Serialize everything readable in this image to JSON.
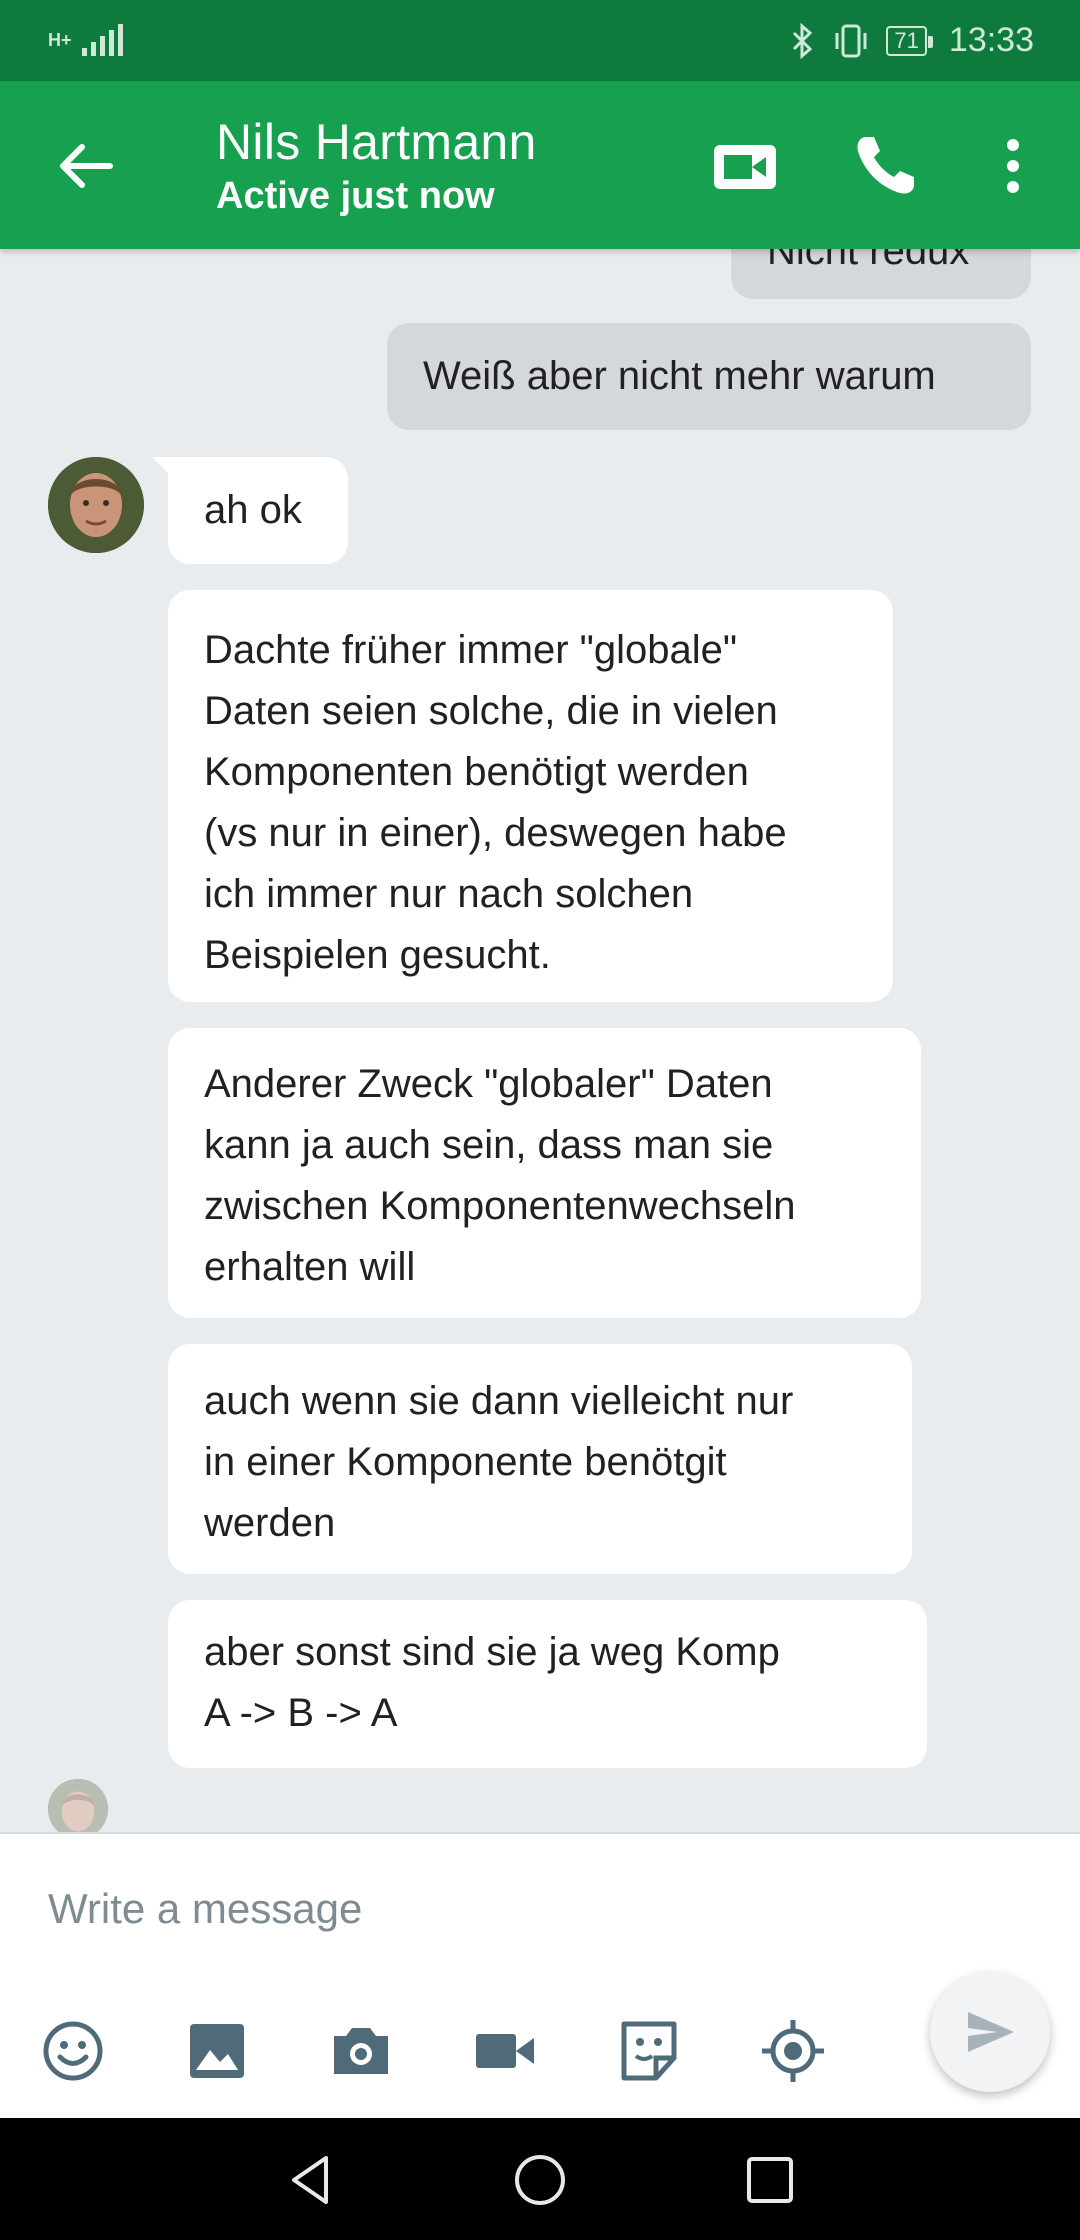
{
  "status_bar": {
    "time": "13:33",
    "battery": "71",
    "network": "H+"
  },
  "header": {
    "contact_name": "Nils Hartmann",
    "contact_status": "Active just now"
  },
  "messages": [
    {
      "direction": "out",
      "text": "Nicht redux"
    },
    {
      "direction": "out",
      "text": "Weiß aber nicht mehr warum"
    },
    {
      "direction": "in",
      "text": "ah ok"
    },
    {
      "direction": "in",
      "lines": [
        "Dachte früher immer \"globale\"",
        "Daten seien solche, die in vielen",
        "Komponenten benötigt werden",
        "(vs nur in einer), deswegen habe",
        "ich immer nur nach solchen",
        "Beispielen gesucht."
      ]
    },
    {
      "direction": "in",
      "lines": [
        "Anderer Zweck \"globaler\" Daten",
        "kann ja auch sein, dass man sie",
        "zwischen Komponentenwechseln",
        "erhalten will"
      ]
    },
    {
      "direction": "in",
      "lines": [
        "auch wenn sie dann vielleicht nur",
        "in einer Komponente benötgit",
        "werden"
      ]
    },
    {
      "direction": "in",
      "lines": [
        "aber sonst sind sie ja weg Komp",
        "A -> B -> A"
      ]
    }
  ],
  "composer": {
    "placeholder": "Write a message"
  },
  "icons": {
    "back": "arrow-back-icon",
    "video": "video-call-icon",
    "call": "phone-icon",
    "more": "more-vert-icon",
    "emoji": "emoji-icon",
    "gallery": "image-icon",
    "camera": "camera-icon",
    "video_message": "video-icon",
    "sticker": "sticker-icon",
    "location": "location-icon",
    "send": "send-icon"
  },
  "colors": {
    "status_bar": "#0e7a3e",
    "app_bar": "#16a04f",
    "chat_background": "#e9ecef",
    "outgoing_bubble": "#d4d8dc",
    "incoming_bubble": "#ffffff",
    "composer_icons": "#4f6b7a"
  }
}
